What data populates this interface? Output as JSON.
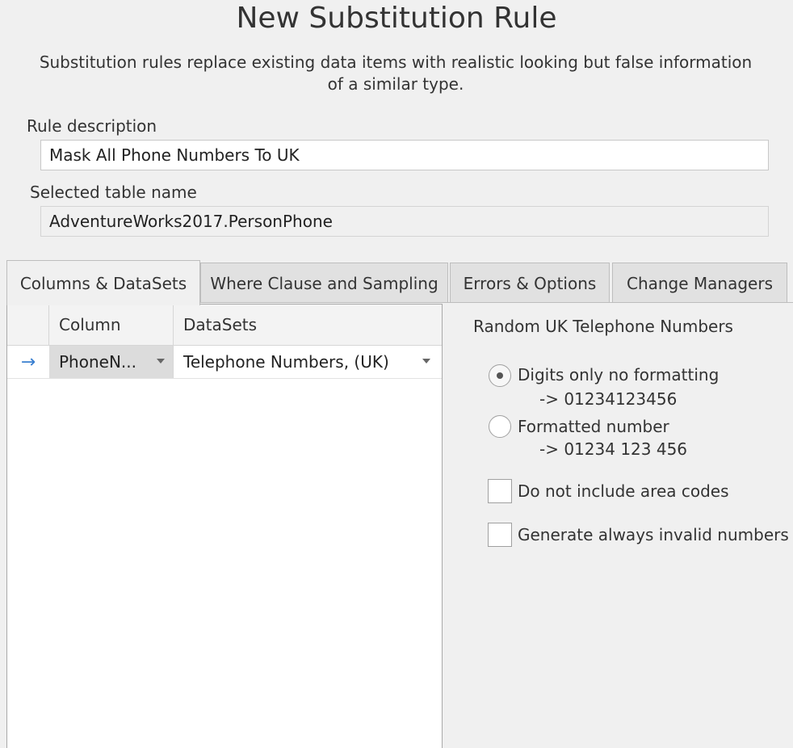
{
  "dialog": {
    "title": "New Substitution Rule",
    "subtitle": "Substitution rules replace existing data items with realistic looking but false information of a similar type."
  },
  "form": {
    "rule_description_label": "Rule description",
    "rule_description_value": "Mask All Phone Numbers To UK",
    "table_name_label": "Selected table name",
    "table_name_value": "AdventureWorks2017.PersonPhone"
  },
  "tabs": [
    {
      "label": "Columns & DataSets",
      "active": true
    },
    {
      "label": "Where Clause and Sampling",
      "active": false
    },
    {
      "label": "Errors & Options",
      "active": false
    },
    {
      "label": "Change Managers",
      "active": false
    }
  ],
  "grid": {
    "columns": [
      "Column",
      "DataSets"
    ],
    "rows": [
      {
        "indicator": "→",
        "column": "PhoneN...",
        "dataset": "Telephone Numbers, (UK)"
      }
    ]
  },
  "options": {
    "title": "Random UK Telephone Numbers",
    "radios": [
      {
        "label": "Digits only no formatting",
        "example": "-> 01234123456",
        "checked": true
      },
      {
        "label": "Formatted number",
        "example": "-> 01234 123 456",
        "checked": false
      }
    ],
    "checkboxes": [
      {
        "label": "Do not include area codes",
        "checked": false
      },
      {
        "label": "Generate always invalid numbers",
        "checked": false
      }
    ]
  },
  "colors": {
    "background": "#f0f0f0",
    "row_indicator": "#3a7fd0"
  }
}
